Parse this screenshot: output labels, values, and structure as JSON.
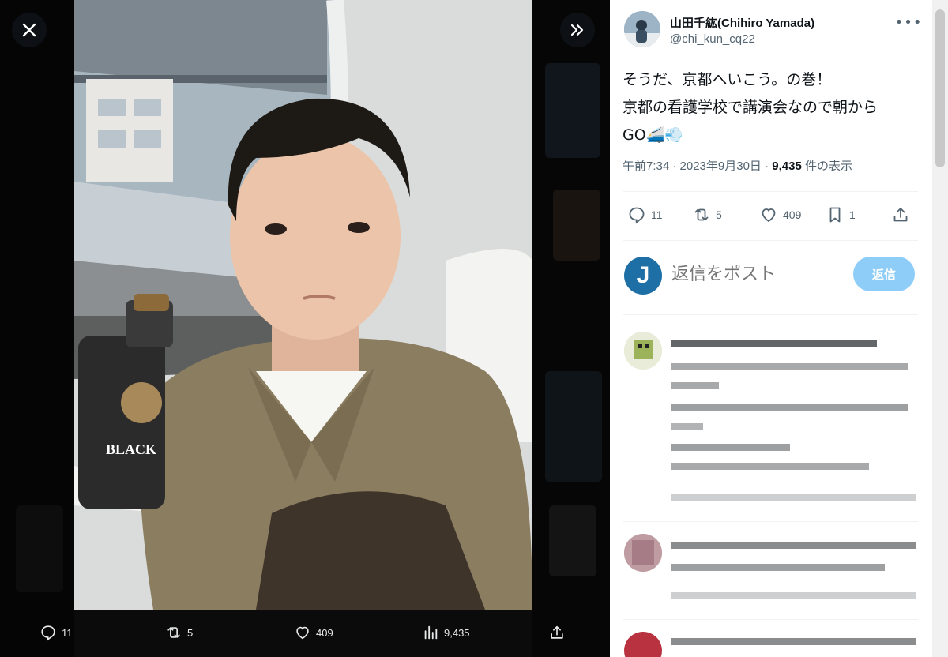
{
  "media": {
    "stats": {
      "replies": "11",
      "reposts": "5",
      "likes": "409",
      "views": "9,435"
    }
  },
  "tweet": {
    "author_name": "山田千紘(Chihiro Yamada)",
    "author_handle": "@chi_kun_cq22",
    "text_line1": "そうだ、京都へいこう。の巻！",
    "text_line2": "京都の看護学校で講演会なので朝から",
    "text_line3": "GO🚄💨",
    "time": "午前7:34 · 2023年9月30日 · ",
    "views_count": "9,435",
    "views_label": " 件の表示",
    "stats": {
      "replies": "11",
      "reposts": "5",
      "likes": "409",
      "bookmarks": "1"
    }
  },
  "reply_box": {
    "avatar_letter": "J",
    "placeholder": "返信をポスト",
    "button_label": "返信"
  },
  "colors": {
    "accent": "#1d9bf0",
    "reply_button": "#8ecdf7",
    "text_secondary": "#536471"
  }
}
